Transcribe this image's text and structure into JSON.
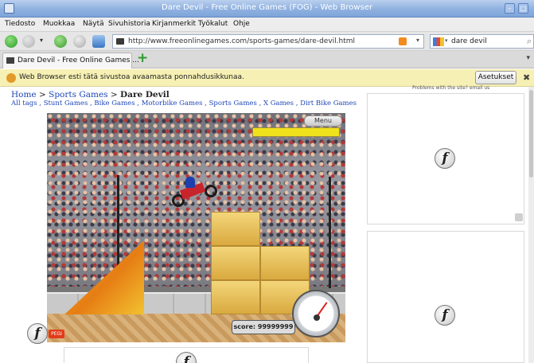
{
  "window": {
    "title": "Dare Devil - Free Online Games (FOG) - Web Browser"
  },
  "menu": [
    "Tiedosto",
    "Muokkaa",
    "Näytä",
    "Sivuhistoria",
    "Kirjanmerkit",
    "Työkalut",
    "Ohje"
  ],
  "nav": {
    "url": "http://www.freeonlinegames.com/sports-games/dare-devil.html",
    "search_value": "dare devil"
  },
  "tabs": {
    "active_label": "Dare Devil - Free Online Games ..."
  },
  "notice": {
    "text": "Web Browser esti tätä sivustoa avaamasta ponnahdusikkunaa.",
    "settings_button": "Asetukset"
  },
  "breadcrumb": {
    "home": "Home",
    "sep1": " > ",
    "category": "Sports Games",
    "sep2": " > ",
    "current": "Dare Devil"
  },
  "tags": {
    "prefix": "All tags",
    "items": [
      "Stunt Games",
      "Bike Games",
      "Motorbike Games",
      "Sports Games",
      "X Games",
      "Dirt Bike Games"
    ]
  },
  "game": {
    "menu_button": "Menu",
    "score_text": "score: 99999999",
    "energy_fraction": 1.0,
    "rating_badge": "PEGI"
  },
  "sidebar": {
    "problem_text": "Problems with the site? email us"
  },
  "icons": {
    "flash": "flash-player-icon",
    "back": "back-arrow-icon",
    "forward": "forward-arrow-icon",
    "reload": "reload-icon",
    "stop": "stop-icon",
    "home": "home-icon",
    "new_tab": "plus-icon",
    "search": "magnifier-icon",
    "rss": "rss-feed-icon",
    "popup_blocker": "warning-icon",
    "close": "close-icon"
  },
  "colors": {
    "link": "#1f46b8",
    "notice_bg": "#f6f0b4",
    "titlebar": "#8fb1e0"
  }
}
